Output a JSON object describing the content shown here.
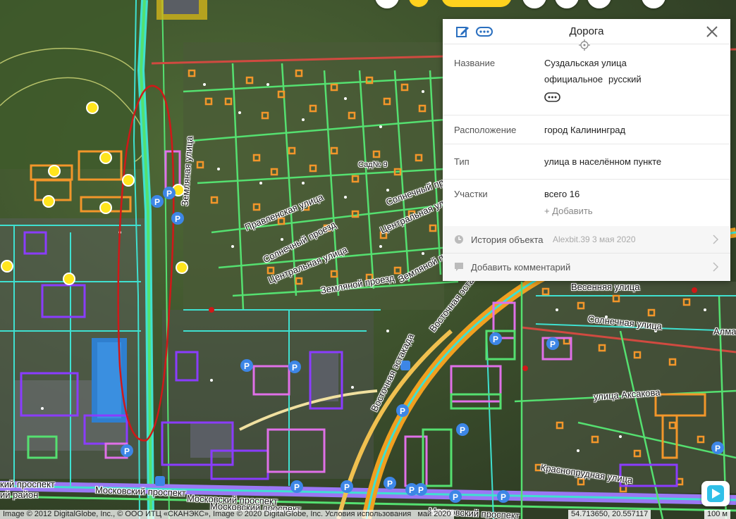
{
  "panel": {
    "title": "Дорога",
    "edit_icon": "edit-icon",
    "more_icon": "ellipsis-icon",
    "close_icon": "close-icon",
    "name_label": "Название",
    "name_value": "Суздальская улица",
    "name_type": "официальное",
    "name_lang": "русский",
    "location_label": "Расположение",
    "location_value": "город Калининград",
    "type_label": "Тип",
    "type_value": "улица в населённом пункте",
    "sections_label": "Участки",
    "sections_value": "всего 16",
    "add_label": "+ Добавить",
    "history_label": "История объекта",
    "history_meta": "Alexbit.39 3 мая 2020",
    "comment_label": "Добавить комментарий"
  },
  "map_labels": {
    "pravlenskaya": "Правленская улица",
    "solnechny_proezd": "Солнечный проезд",
    "tsentralnaya": "Центральная улица",
    "zemlyanoy_proezd": "Земляной проезд",
    "zemlyanaya": "Земляная улица",
    "solnechny_right": "Солнечный проезд",
    "tsentralnaya_right": "Центральная улица",
    "zemlyanoy_right": "Земляной проезд",
    "sad9": "Сад№ 9",
    "vesennyaya": "Весенняя улица",
    "solnechnaya": "Солнечная улица",
    "almaz": "Алмаз",
    "vostochnaya_estakada": "Восточная эстакада",
    "vostochnaya_estakada2": "Восточная эстакада",
    "aksakova": "улица Аксакова",
    "krasnoprudnaya": "Краснопрудная улица",
    "moskovsky1": "Московский проспект",
    "moskovsky2": "Московский проспект",
    "moskovsky3": "Московский проспект",
    "moskovsky4": "Московский проспект",
    "district": "ий район",
    "district2": "кий проспект"
  },
  "footer": {
    "copyright": "Image © 2012 DigitalGlobe, Inc., © ООО ИТЦ «СКАНЭКС», Image © 2020 DigitalGlobe, Inc. Условия использования",
    "date_fragment": "май 2020",
    "coords": "54.713650, 20.557117",
    "scale": "100 м"
  },
  "colors": {
    "road_cyan": "#3fe0d0",
    "road_green": "#55e070",
    "building_orange": "#f2962a",
    "building_purple": "#8a3cff",
    "building_pink": "#e070e8",
    "highway_orange": "#f0a020",
    "selection_red": "#d01818",
    "parking_blue": "#3d86e6",
    "poi_yellow": "#ffe51e"
  }
}
